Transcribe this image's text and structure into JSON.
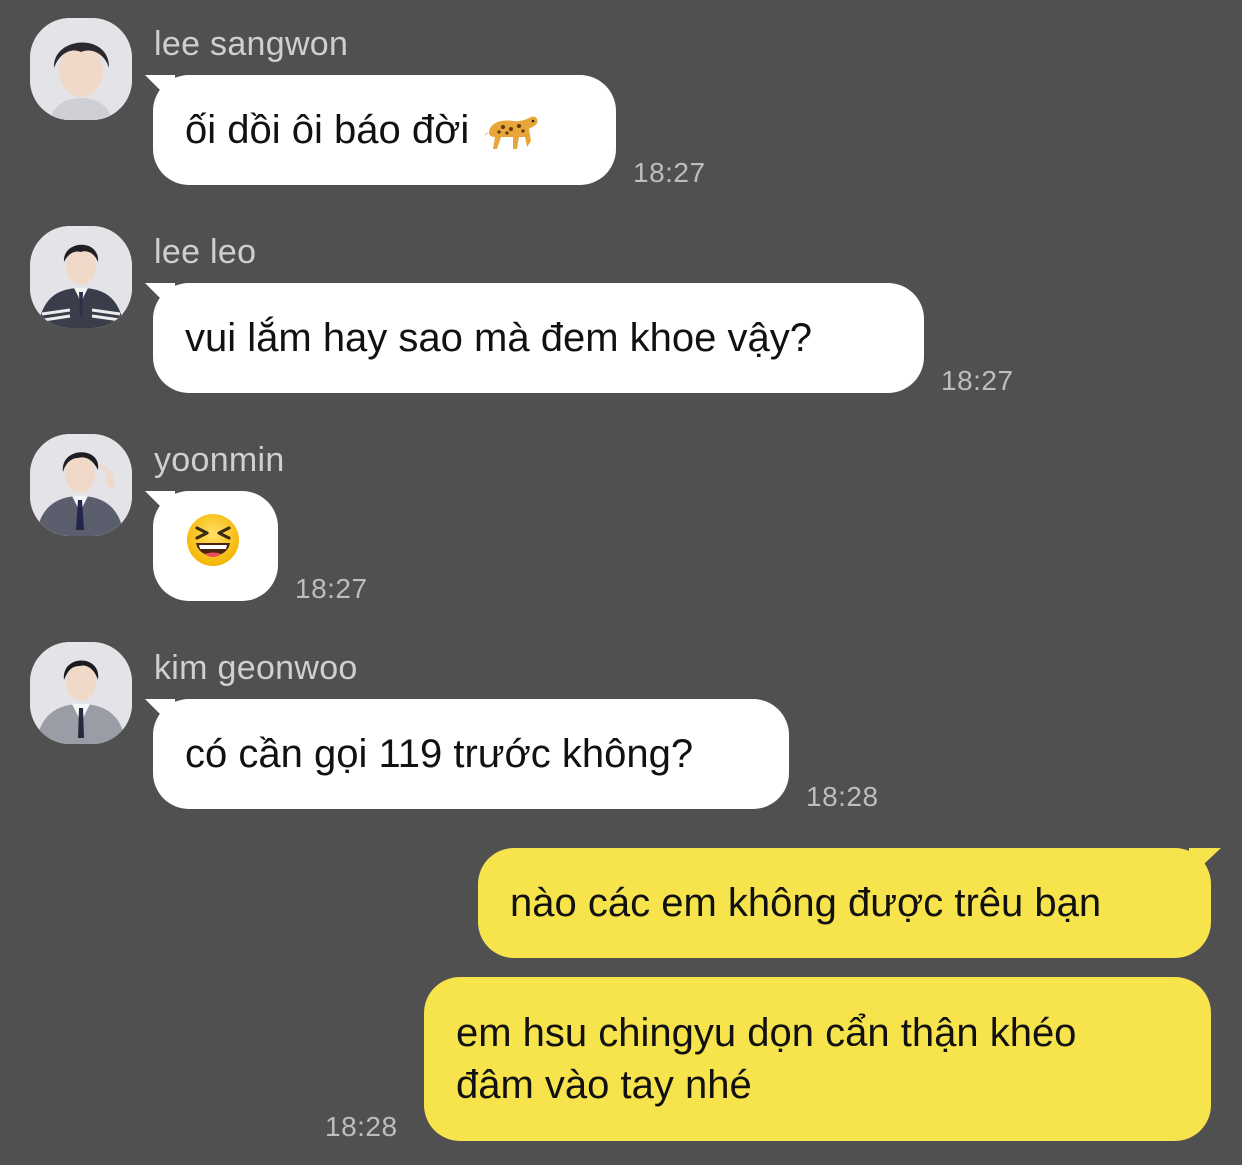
{
  "messages": [
    {
      "sender": "lee sangwon",
      "text": "ối dồi ôi báo đời",
      "time": "18:27",
      "icon": "leopard-emoji"
    },
    {
      "sender": "lee leo",
      "text": "vui lắm hay sao mà đem khoe vậy?",
      "time": "18:27"
    },
    {
      "sender": "yoonmin",
      "text": "",
      "time": "18:27",
      "icon": "laughing-squint-emoji"
    },
    {
      "sender": "kim geonwoo",
      "text": "có cần gọi 119 trước không?",
      "time": "18:28"
    }
  ],
  "outgoing": [
    {
      "text": "nào các em không được trêu bạn"
    },
    {
      "line1": "em hsu chingyu dọn cẩn thận khéo",
      "line2": "đâm vào tay nhé",
      "time": "18:28"
    }
  ],
  "colors": {
    "background": "#505050",
    "incoming_bubble": "#ffffff",
    "outgoing_bubble": "#f7e34b",
    "timestamp": "#bdbdbd",
    "sender_name": "#cfcfcf"
  }
}
